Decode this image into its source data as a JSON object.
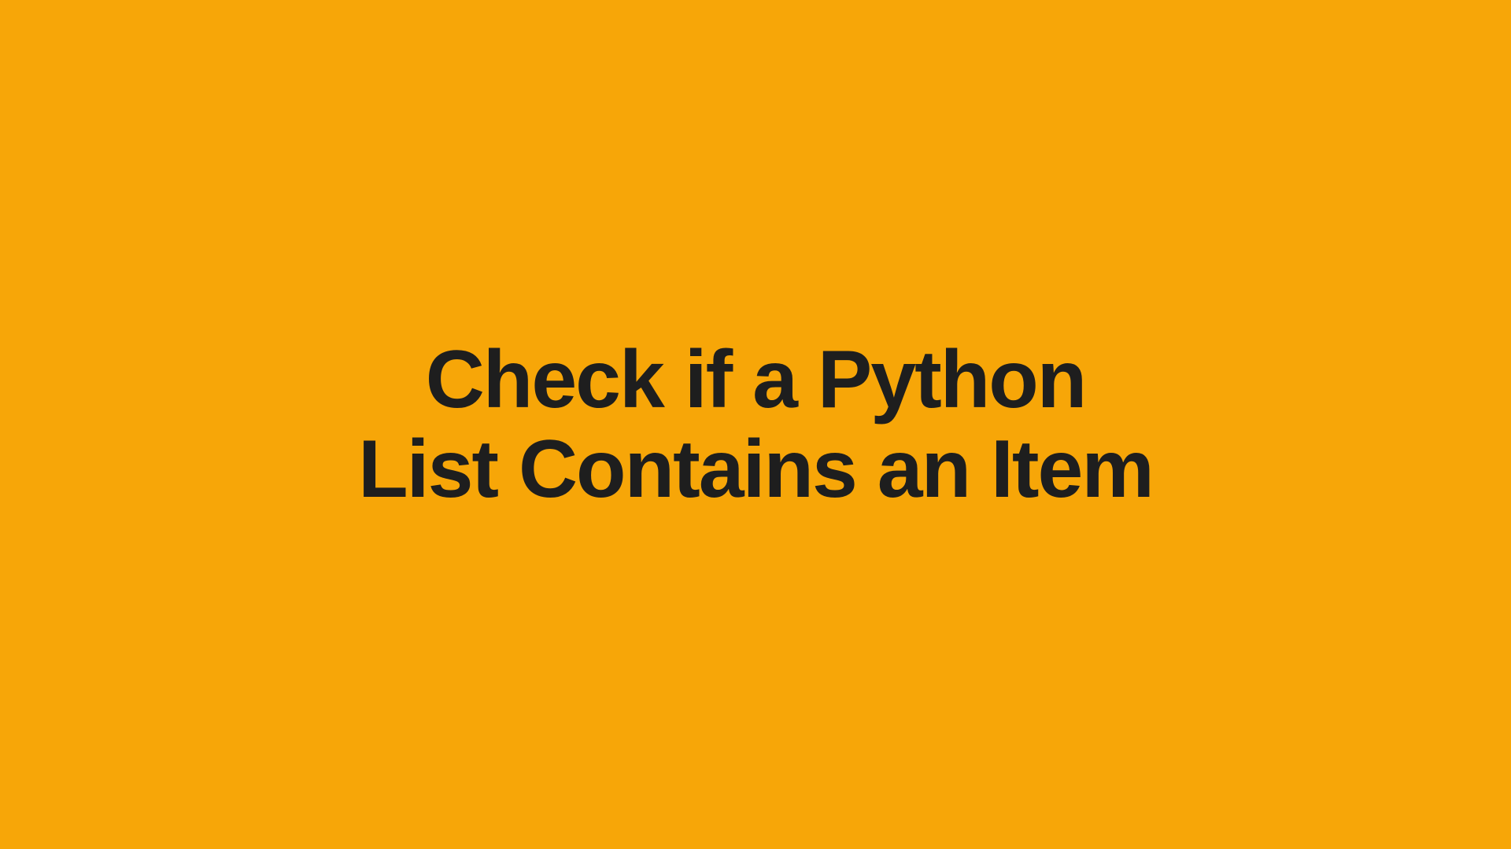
{
  "title": {
    "line1": "Check if a Python",
    "line2": "List Contains an Item"
  },
  "colors": {
    "background": "#f7a608",
    "text": "#1e1e1e"
  }
}
